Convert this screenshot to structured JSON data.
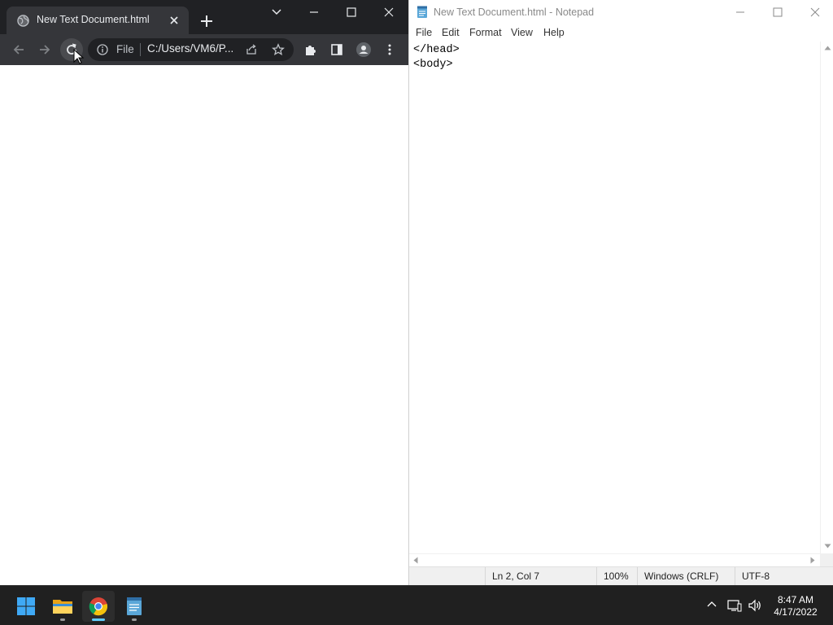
{
  "chrome": {
    "tab_title": "New Text Document.html",
    "omnibox_scheme": "File",
    "omnibox_url": "C:/Users/VM6/P...",
    "page_content": ""
  },
  "notepad": {
    "window_title": "New Text Document.html - Notepad",
    "menu": [
      "File",
      "Edit",
      "Format",
      "View",
      "Help"
    ],
    "content": "</head>\n<body>",
    "status": {
      "position": "Ln 2, Col 7",
      "zoom": "100%",
      "line_ending": "Windows (CRLF)",
      "encoding": "UTF-8"
    }
  },
  "taskbar": {
    "apps": [
      "start-icon",
      "file-explorer-icon",
      "chrome-icon",
      "notepad-icon"
    ],
    "active_app": "chrome-icon",
    "time": "8:47 AM",
    "date": "4/17/2022"
  },
  "colors": {
    "chrome_tabstrip": "#202124",
    "chrome_toolbar": "#35363a",
    "taskbar": "#202020",
    "accent": "#60cdff"
  }
}
